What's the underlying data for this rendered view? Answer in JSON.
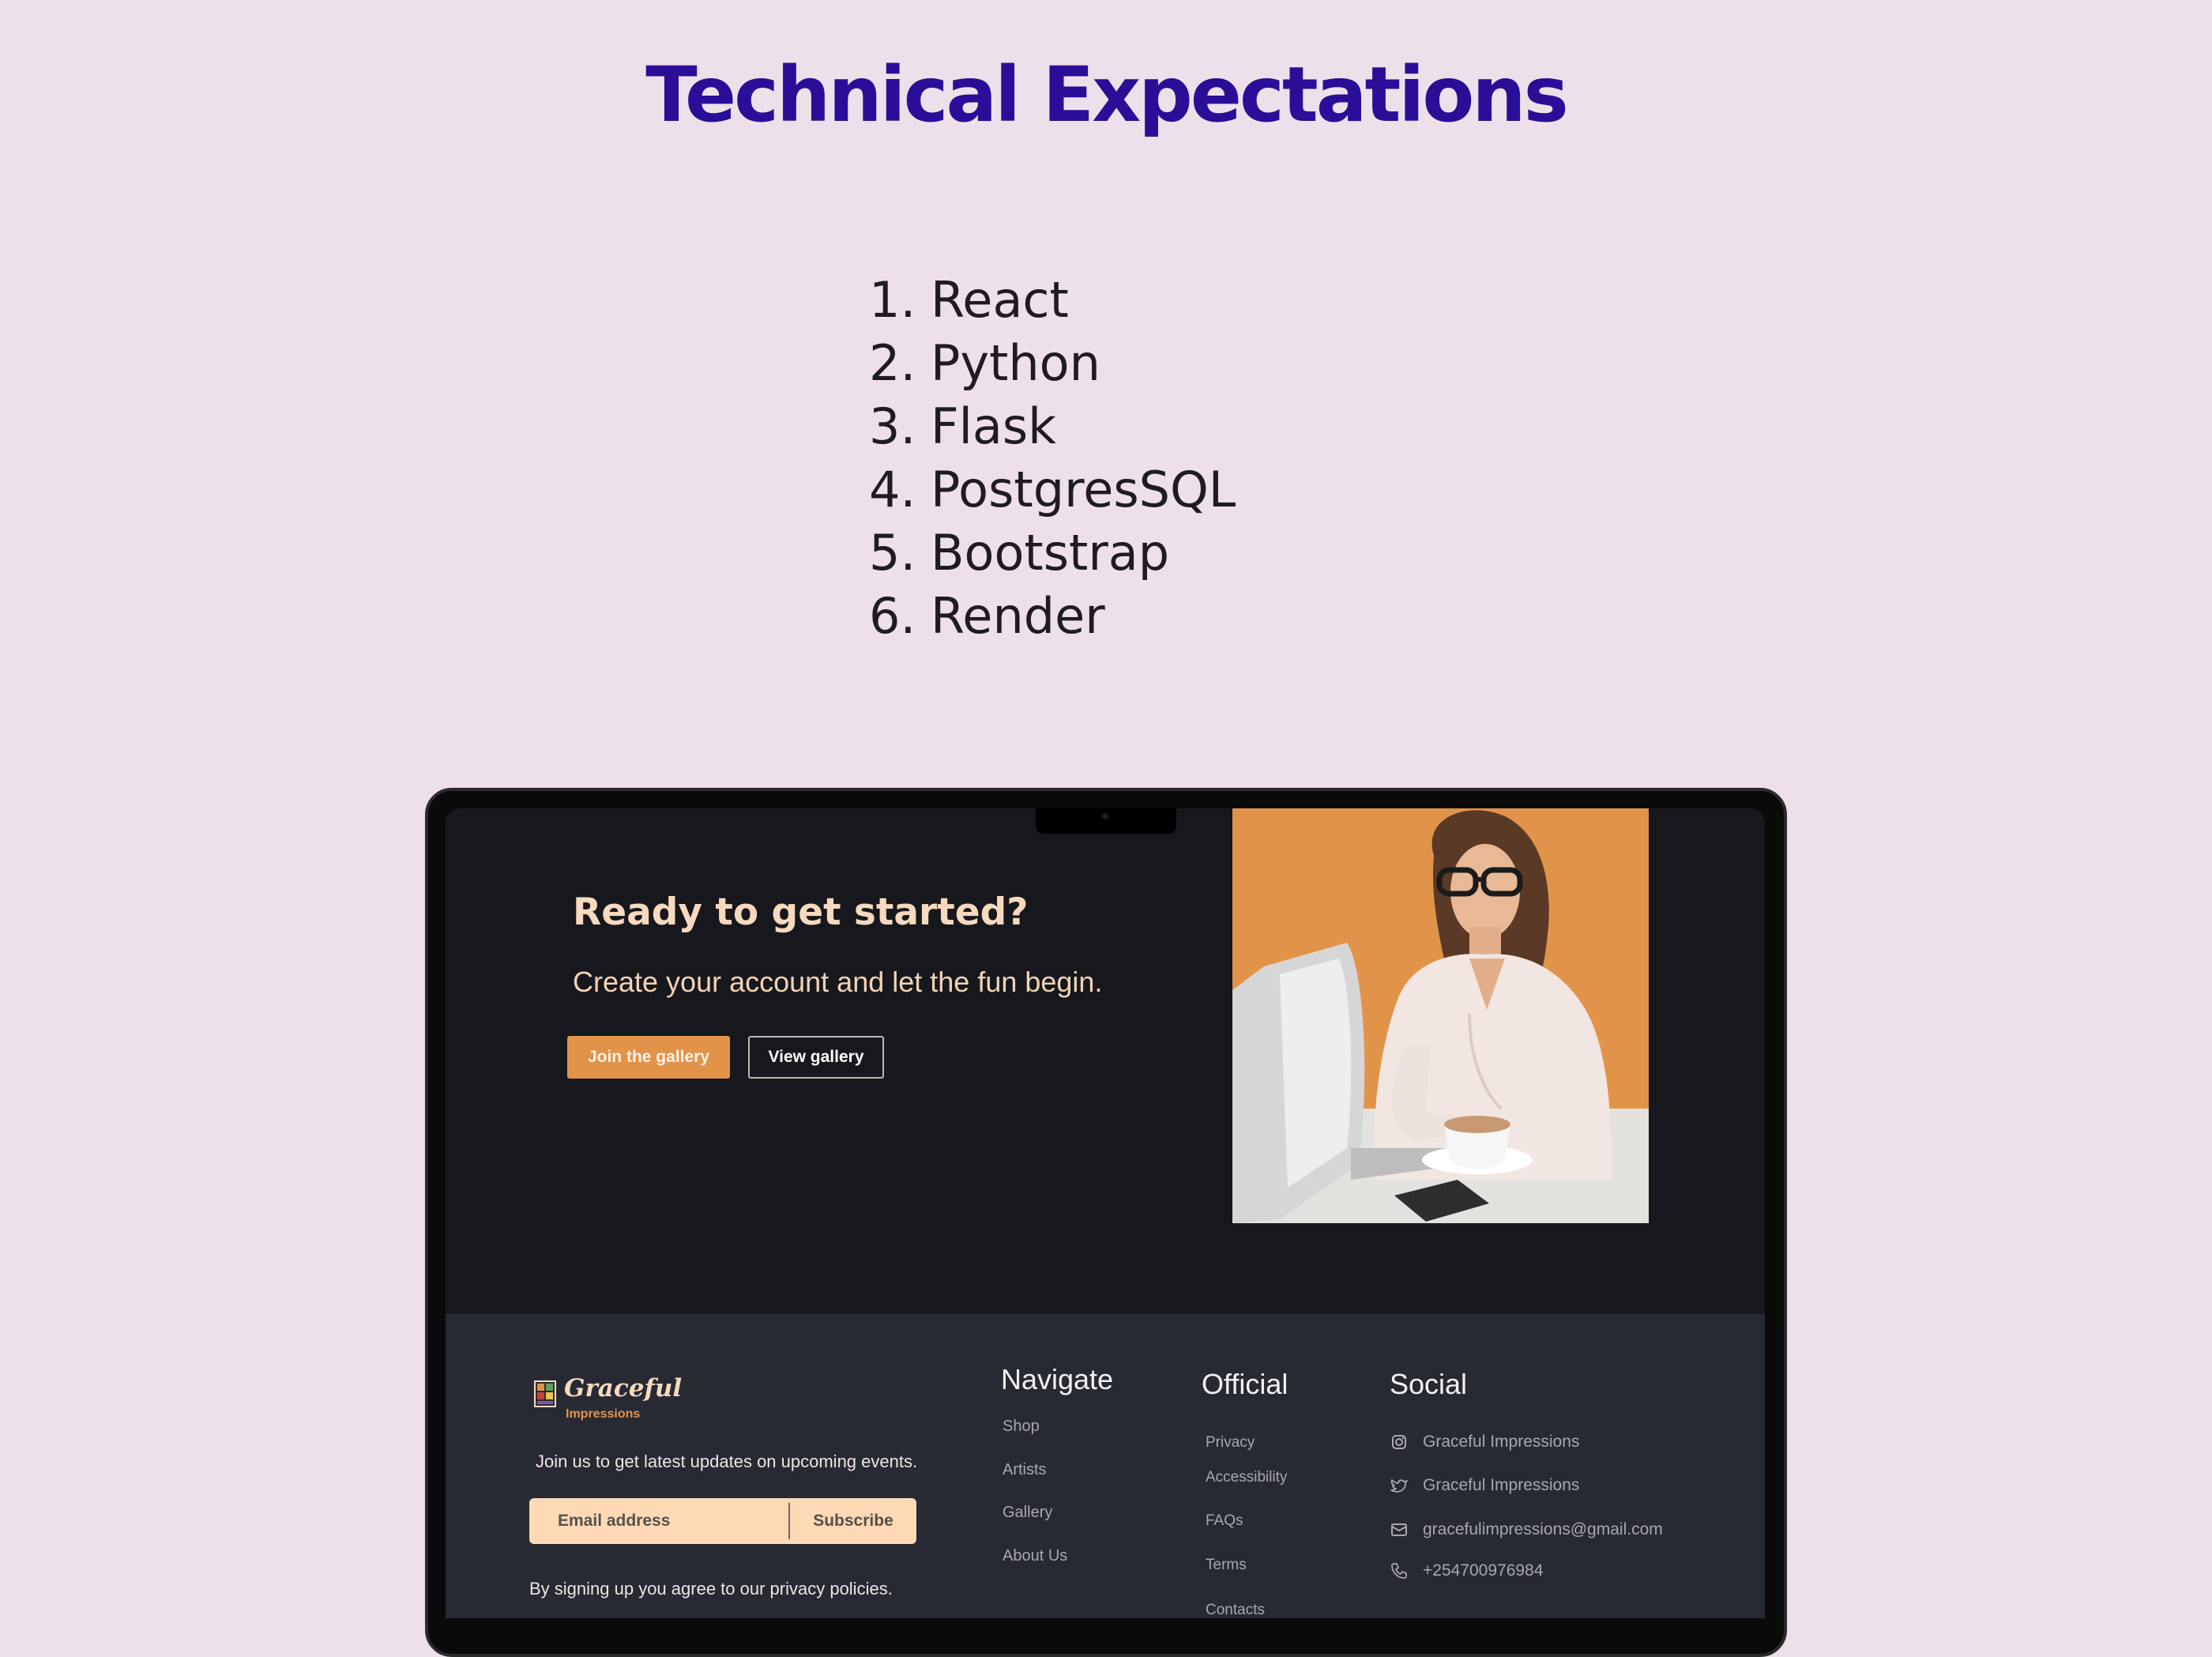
{
  "slide": {
    "title": "Technical Expectations",
    "tech_list": [
      {
        "num": "1.",
        "label": "React"
      },
      {
        "num": "2.",
        "label": "Python"
      },
      {
        "num": "3.",
        "label": "Flask"
      },
      {
        "num": "4.",
        "label": "PostgresSQL"
      },
      {
        "num": "5.",
        "label": "Bootstrap"
      },
      {
        "num": "6.",
        "label": "Render"
      }
    ]
  },
  "hero": {
    "heading": "Ready to get started?",
    "subheading": "Create your account and let the fun begin.",
    "join_button": "Join the gallery",
    "view_button": "View gallery",
    "image_icon": "woman-with-laptop-photo"
  },
  "footer": {
    "brand": {
      "name": "Graceful",
      "sub": "Impressions"
    },
    "tagline": "Join us to get latest updates on upcoming events.",
    "email_placeholder": "Email address",
    "subscribe_label": "Subscribe",
    "note": "By signing up you agree to our privacy policies.",
    "navigate": {
      "heading": "Navigate",
      "links": [
        "Shop",
        "Artists",
        "Gallery",
        "About Us"
      ]
    },
    "official": {
      "heading": "Official",
      "links": [
        "Privacy",
        "Accessibility",
        "FAQs",
        "Terms",
        "Contacts"
      ]
    },
    "social": {
      "heading": "Social",
      "items": [
        {
          "icon": "instagram-icon",
          "label": "Graceful Impressions"
        },
        {
          "icon": "twitter-icon",
          "label": "Graceful Impressions"
        },
        {
          "icon": "mail-icon",
          "label": "gracefulimpressions@gmail.com"
        },
        {
          "icon": "phone-icon",
          "label": "+254700976984"
        }
      ]
    }
  },
  "colors": {
    "background": "#EEE0EA",
    "title": "#2A0E98",
    "accent": "#E2934A",
    "cream": "#F7D9BE",
    "screen": "#17181D",
    "footer": "#272A33"
  }
}
